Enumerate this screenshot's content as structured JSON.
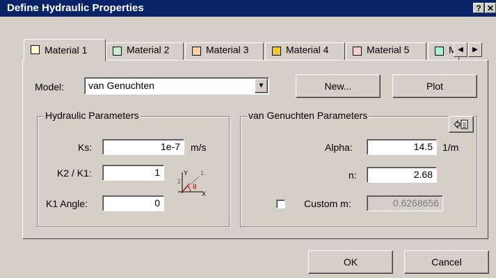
{
  "window": {
    "title": "Define Hydraulic Properties",
    "help_btn": "?",
    "close_btn": "✕"
  },
  "tabs": [
    {
      "label": "Material 1",
      "color": "#ffffc8"
    },
    {
      "label": "Material 2",
      "color": "#c8f0c8"
    },
    {
      "label": "Material 3",
      "color": "#ffd0a0"
    },
    {
      "label": "Material 4",
      "color": "#f0c828"
    },
    {
      "label": "Material 5",
      "color": "#ffd0d0"
    },
    {
      "label": "M",
      "color": "#a8f0d8"
    }
  ],
  "model": {
    "label": "Model:",
    "value": "van Genuchten",
    "new_label": "New...",
    "plot_label": "Plot"
  },
  "hydraulic": {
    "title": "Hydraulic Parameters",
    "ks_label": "Ks:",
    "ks_value": "1e-7",
    "ks_unit": "m/s",
    "k2k1_label": "K2 / K1:",
    "k2k1_value": "1",
    "angle_label": "K1 Angle:",
    "angle_value": "0",
    "axis_y": "Y",
    "axis_x": "X",
    "axis_1": "1",
    "axis_2": "2",
    "axis_theta": "θ"
  },
  "vg": {
    "title": "van Genuchten Parameters",
    "alpha_label": "Alpha:",
    "alpha_value": "14.5",
    "alpha_unit": "1/m",
    "n_label": "n:",
    "n_value": "2.68",
    "custom_label": "Custom m:",
    "custom_value": "0.6268656",
    "custom_checked": false
  },
  "footer": {
    "ok_label": "OK",
    "cancel_label": "Cancel"
  }
}
